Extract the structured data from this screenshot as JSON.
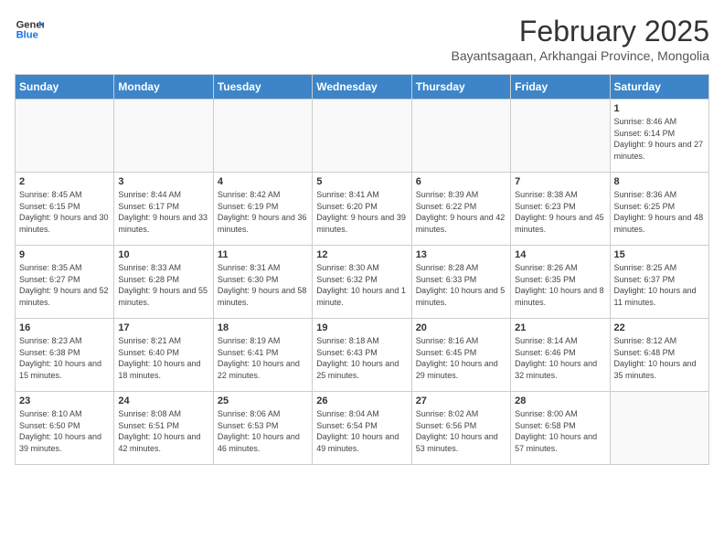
{
  "header": {
    "logo_general": "General",
    "logo_blue": "Blue",
    "month": "February 2025",
    "location": "Bayantsagaan, Arkhangai Province, Mongolia"
  },
  "weekdays": [
    "Sunday",
    "Monday",
    "Tuesday",
    "Wednesday",
    "Thursday",
    "Friday",
    "Saturday"
  ],
  "weeks": [
    [
      {
        "day": "",
        "info": ""
      },
      {
        "day": "",
        "info": ""
      },
      {
        "day": "",
        "info": ""
      },
      {
        "day": "",
        "info": ""
      },
      {
        "day": "",
        "info": ""
      },
      {
        "day": "",
        "info": ""
      },
      {
        "day": "1",
        "info": "Sunrise: 8:46 AM\nSunset: 6:14 PM\nDaylight: 9 hours and 27 minutes."
      }
    ],
    [
      {
        "day": "2",
        "info": "Sunrise: 8:45 AM\nSunset: 6:15 PM\nDaylight: 9 hours and 30 minutes."
      },
      {
        "day": "3",
        "info": "Sunrise: 8:44 AM\nSunset: 6:17 PM\nDaylight: 9 hours and 33 minutes."
      },
      {
        "day": "4",
        "info": "Sunrise: 8:42 AM\nSunset: 6:19 PM\nDaylight: 9 hours and 36 minutes."
      },
      {
        "day": "5",
        "info": "Sunrise: 8:41 AM\nSunset: 6:20 PM\nDaylight: 9 hours and 39 minutes."
      },
      {
        "day": "6",
        "info": "Sunrise: 8:39 AM\nSunset: 6:22 PM\nDaylight: 9 hours and 42 minutes."
      },
      {
        "day": "7",
        "info": "Sunrise: 8:38 AM\nSunset: 6:23 PM\nDaylight: 9 hours and 45 minutes."
      },
      {
        "day": "8",
        "info": "Sunrise: 8:36 AM\nSunset: 6:25 PM\nDaylight: 9 hours and 48 minutes."
      }
    ],
    [
      {
        "day": "9",
        "info": "Sunrise: 8:35 AM\nSunset: 6:27 PM\nDaylight: 9 hours and 52 minutes."
      },
      {
        "day": "10",
        "info": "Sunrise: 8:33 AM\nSunset: 6:28 PM\nDaylight: 9 hours and 55 minutes."
      },
      {
        "day": "11",
        "info": "Sunrise: 8:31 AM\nSunset: 6:30 PM\nDaylight: 9 hours and 58 minutes."
      },
      {
        "day": "12",
        "info": "Sunrise: 8:30 AM\nSunset: 6:32 PM\nDaylight: 10 hours and 1 minute."
      },
      {
        "day": "13",
        "info": "Sunrise: 8:28 AM\nSunset: 6:33 PM\nDaylight: 10 hours and 5 minutes."
      },
      {
        "day": "14",
        "info": "Sunrise: 8:26 AM\nSunset: 6:35 PM\nDaylight: 10 hours and 8 minutes."
      },
      {
        "day": "15",
        "info": "Sunrise: 8:25 AM\nSunset: 6:37 PM\nDaylight: 10 hours and 11 minutes."
      }
    ],
    [
      {
        "day": "16",
        "info": "Sunrise: 8:23 AM\nSunset: 6:38 PM\nDaylight: 10 hours and 15 minutes."
      },
      {
        "day": "17",
        "info": "Sunrise: 8:21 AM\nSunset: 6:40 PM\nDaylight: 10 hours and 18 minutes."
      },
      {
        "day": "18",
        "info": "Sunrise: 8:19 AM\nSunset: 6:41 PM\nDaylight: 10 hours and 22 minutes."
      },
      {
        "day": "19",
        "info": "Sunrise: 8:18 AM\nSunset: 6:43 PM\nDaylight: 10 hours and 25 minutes."
      },
      {
        "day": "20",
        "info": "Sunrise: 8:16 AM\nSunset: 6:45 PM\nDaylight: 10 hours and 29 minutes."
      },
      {
        "day": "21",
        "info": "Sunrise: 8:14 AM\nSunset: 6:46 PM\nDaylight: 10 hours and 32 minutes."
      },
      {
        "day": "22",
        "info": "Sunrise: 8:12 AM\nSunset: 6:48 PM\nDaylight: 10 hours and 35 minutes."
      }
    ],
    [
      {
        "day": "23",
        "info": "Sunrise: 8:10 AM\nSunset: 6:50 PM\nDaylight: 10 hours and 39 minutes."
      },
      {
        "day": "24",
        "info": "Sunrise: 8:08 AM\nSunset: 6:51 PM\nDaylight: 10 hours and 42 minutes."
      },
      {
        "day": "25",
        "info": "Sunrise: 8:06 AM\nSunset: 6:53 PM\nDaylight: 10 hours and 46 minutes."
      },
      {
        "day": "26",
        "info": "Sunrise: 8:04 AM\nSunset: 6:54 PM\nDaylight: 10 hours and 49 minutes."
      },
      {
        "day": "27",
        "info": "Sunrise: 8:02 AM\nSunset: 6:56 PM\nDaylight: 10 hours and 53 minutes."
      },
      {
        "day": "28",
        "info": "Sunrise: 8:00 AM\nSunset: 6:58 PM\nDaylight: 10 hours and 57 minutes."
      },
      {
        "day": "",
        "info": ""
      }
    ]
  ]
}
